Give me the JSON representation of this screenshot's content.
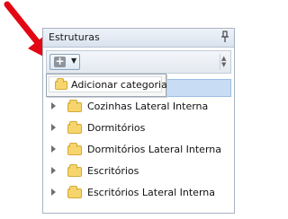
{
  "panel": {
    "title": "Estruturas",
    "pin_icon": "pin-icon"
  },
  "toolbar": {
    "add_icon": "plus-icon",
    "dropdown_icon": "chevron-down-icon"
  },
  "menu": {
    "item_label": "Adicionar categoria",
    "item_icon": "folder-icon"
  },
  "tree": {
    "items": [
      {
        "label": "Cozinhas Lateral Interna",
        "icon": "folder-icon"
      },
      {
        "label": "Dormitórios",
        "icon": "folder-icon"
      },
      {
        "label": "Dormitórios Lateral Interna",
        "icon": "folder-icon"
      },
      {
        "label": "Escritórios",
        "icon": "folder-icon"
      },
      {
        "label": "Escritórios Lateral Interna",
        "icon": "folder-icon"
      }
    ]
  },
  "colors": {
    "arrow": "#e30613",
    "highlight": "#c8ddf4",
    "folder": "#f7d56d"
  }
}
